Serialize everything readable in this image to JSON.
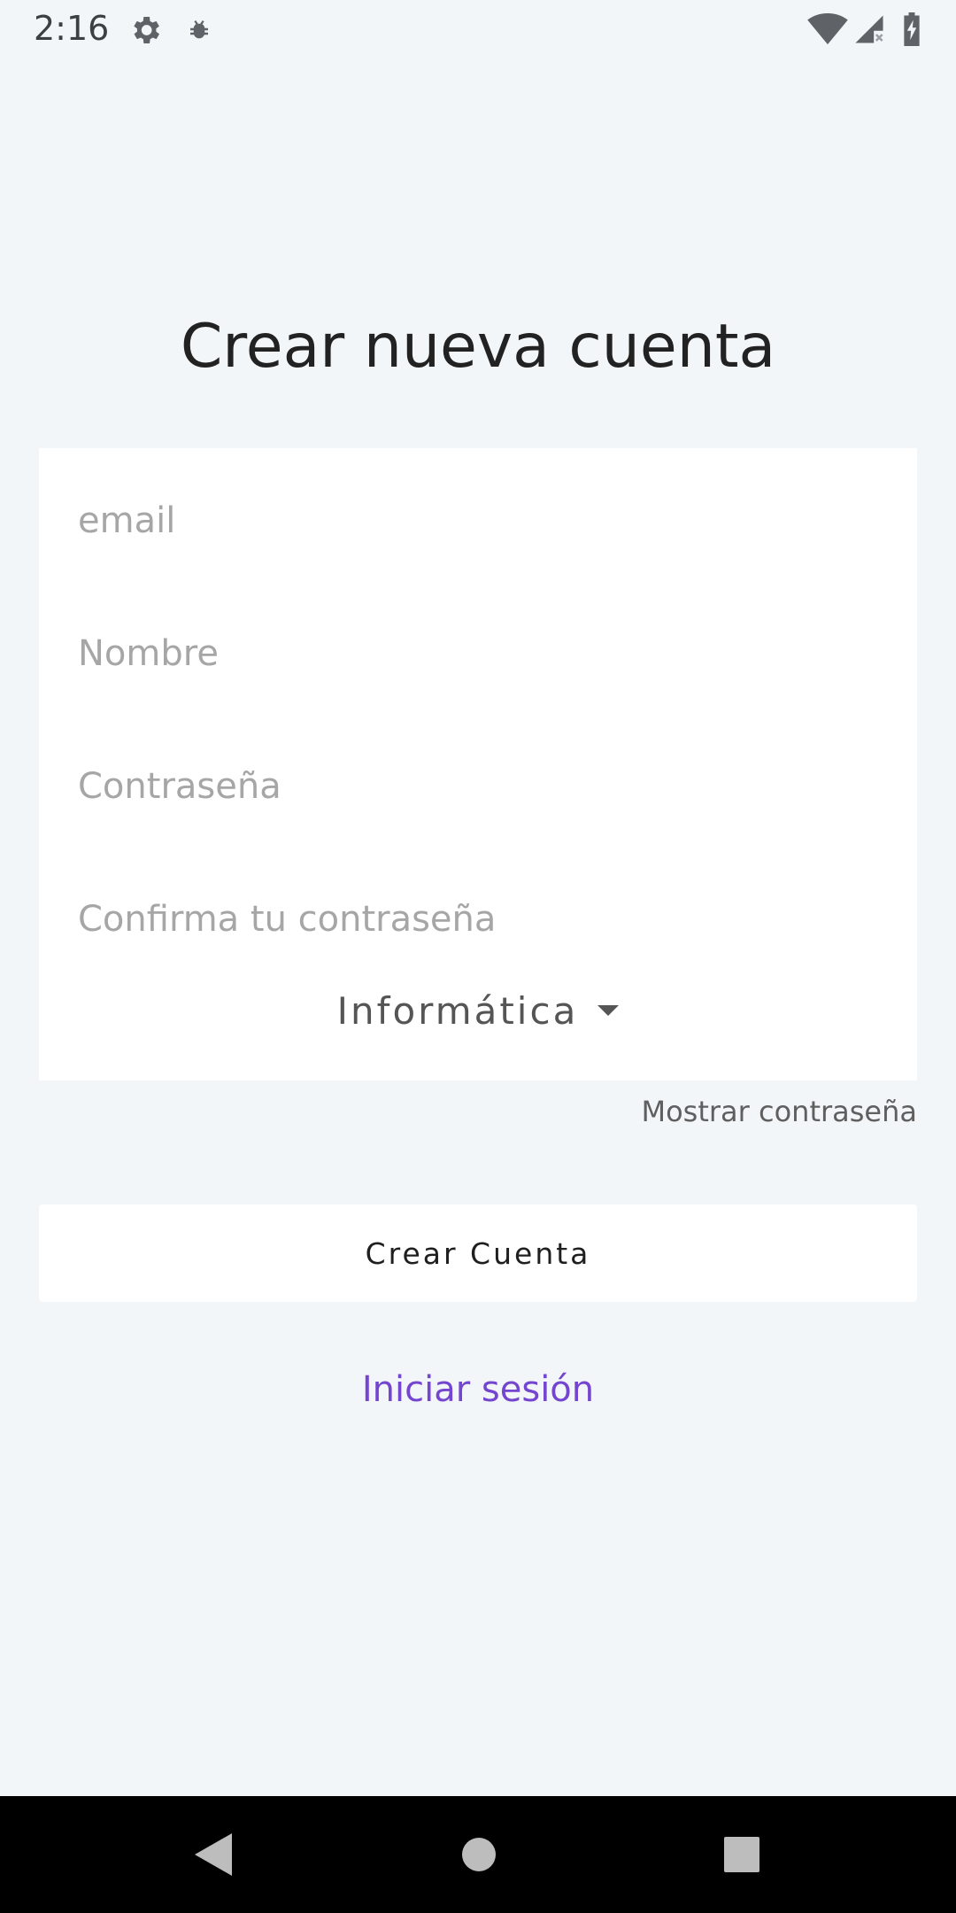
{
  "status_bar": {
    "time": "2:16",
    "icons": [
      "gear-icon",
      "debug-icon",
      "wifi-icon",
      "signal-icon",
      "battery-charging-icon"
    ]
  },
  "signup": {
    "title": "Crear nueva cuenta",
    "fields": {
      "email_placeholder": "email",
      "name_placeholder": "Nombre",
      "password_placeholder": "Contraseña",
      "confirm_placeholder": "Confirma tu contraseña"
    },
    "department_selected": "Informática",
    "show_password_label": "Mostrar contraseña",
    "submit_label": "Crear Cuenta",
    "login_link_label": "Iniciar sesión"
  },
  "nav_bar": {
    "icons": [
      "back-icon",
      "home-icon",
      "recents-icon"
    ]
  },
  "colors": {
    "background": "#f3f6f9",
    "card": "#ffffff",
    "link": "#7445cf",
    "nav_bar": "#000000"
  }
}
